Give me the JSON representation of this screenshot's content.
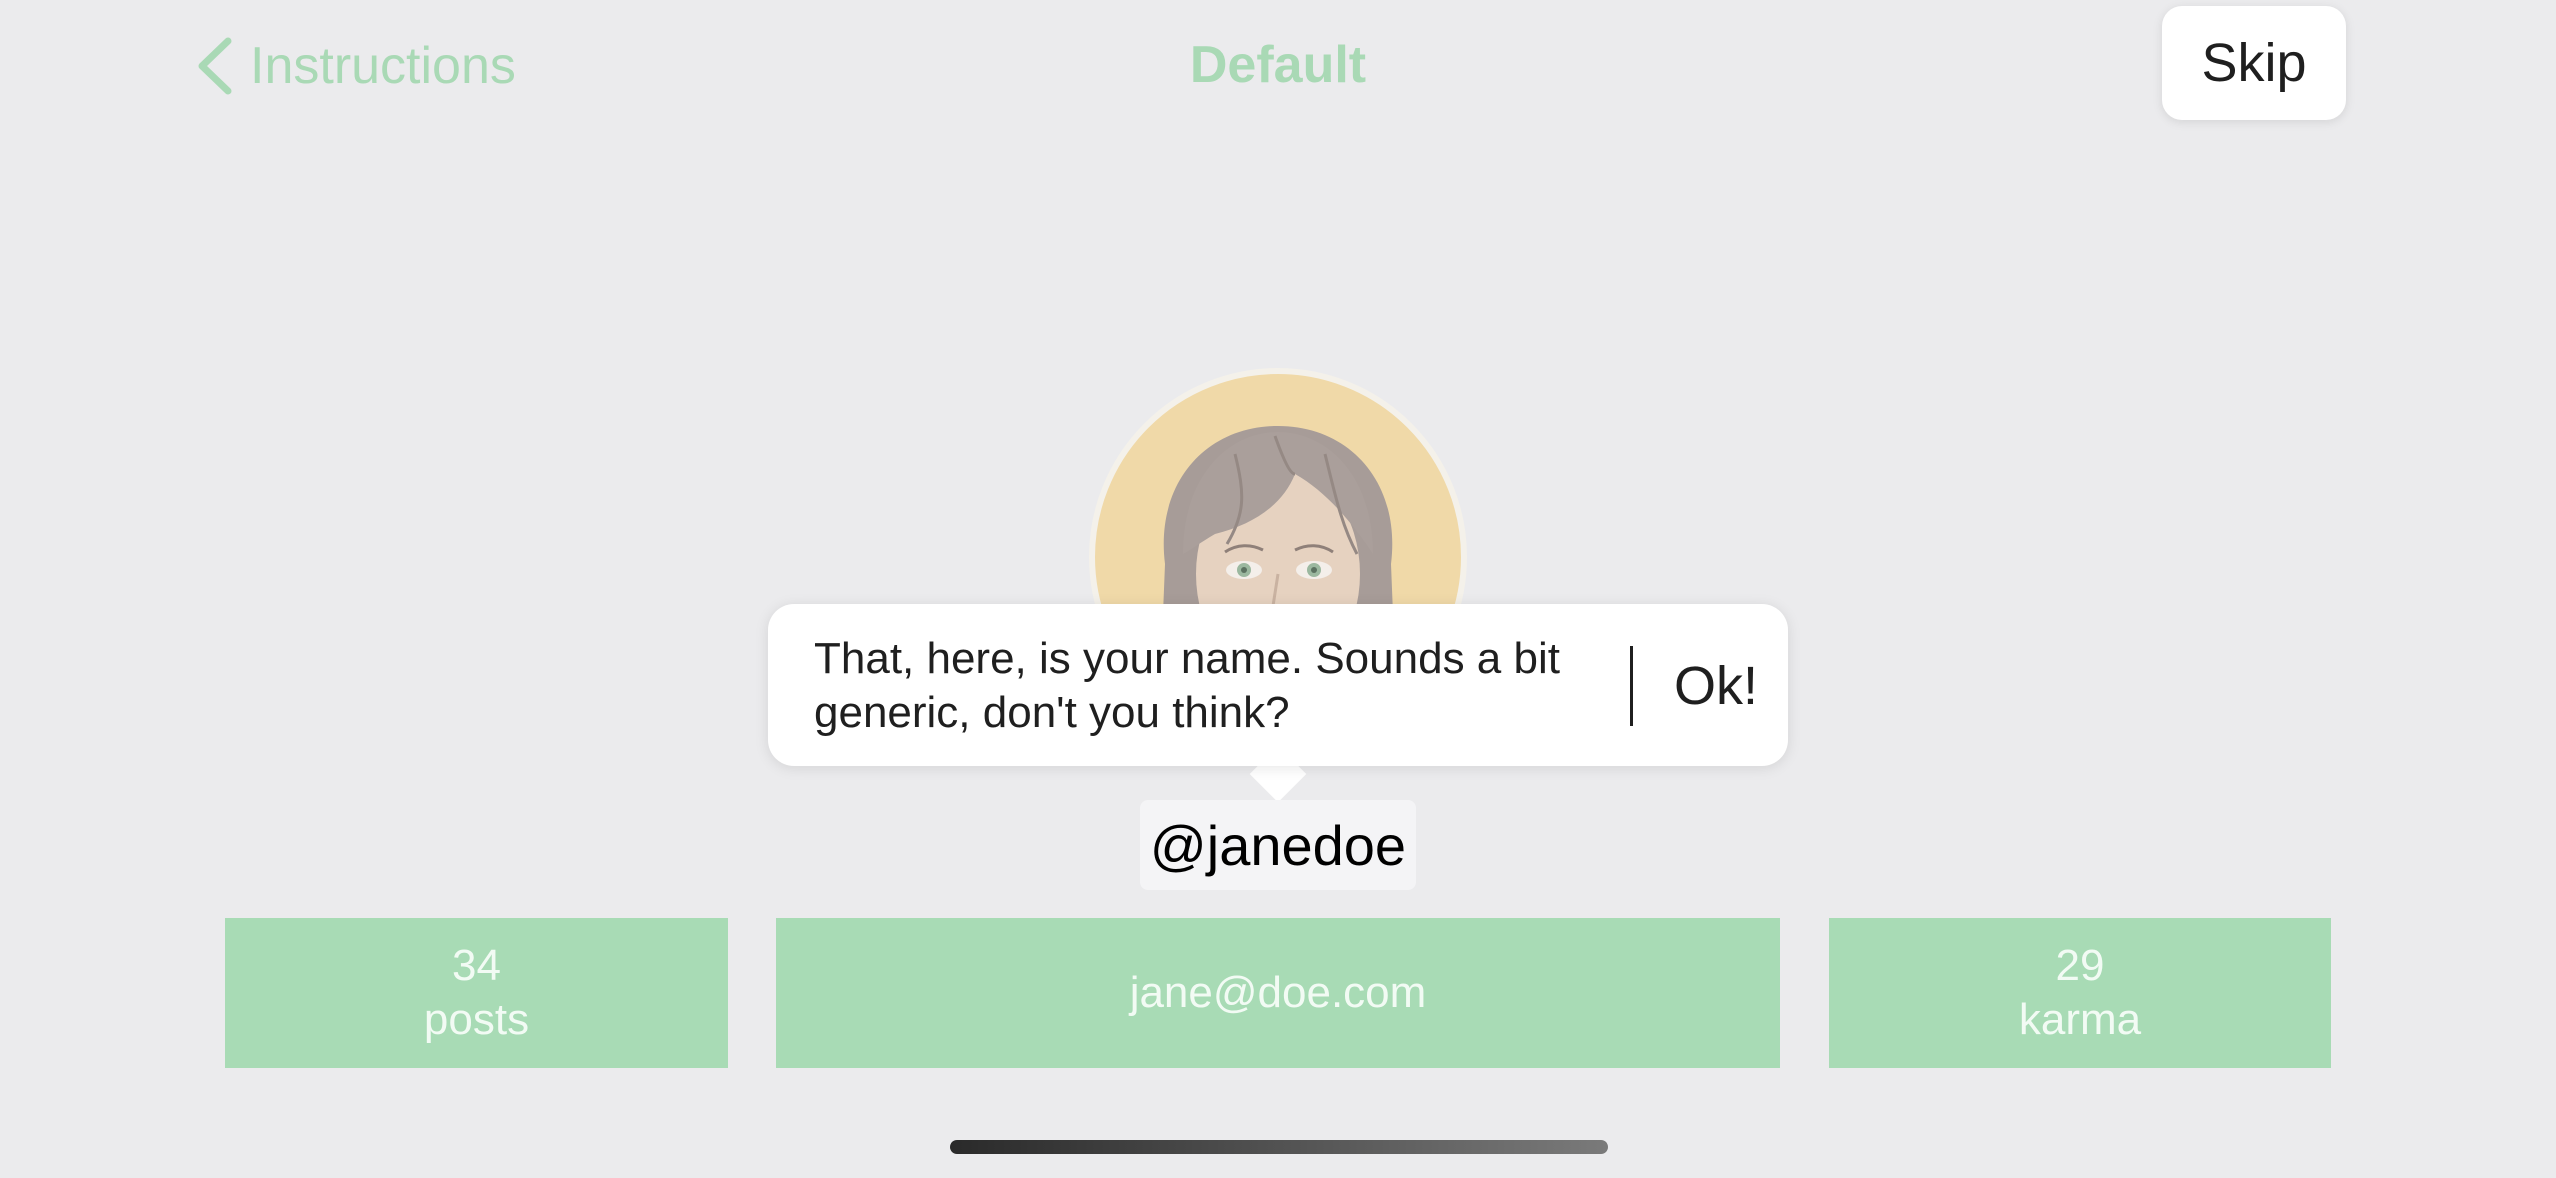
{
  "nav": {
    "back_label": "Instructions",
    "title": "Default",
    "skip_label": "Skip"
  },
  "profile": {
    "username": "@janedoe",
    "email": "jane@doe.com",
    "posts_count": "34",
    "posts_label": "posts",
    "karma_count": "29",
    "karma_label": "karma"
  },
  "tooltip": {
    "message": "That, here, is your name. Sounds a bit generic, don't you think?",
    "ok_label": "Ok!"
  },
  "colors": {
    "accent_green": "#a8dbb5",
    "background": "#ebebed",
    "avatar_background": "#f0d9a8"
  }
}
